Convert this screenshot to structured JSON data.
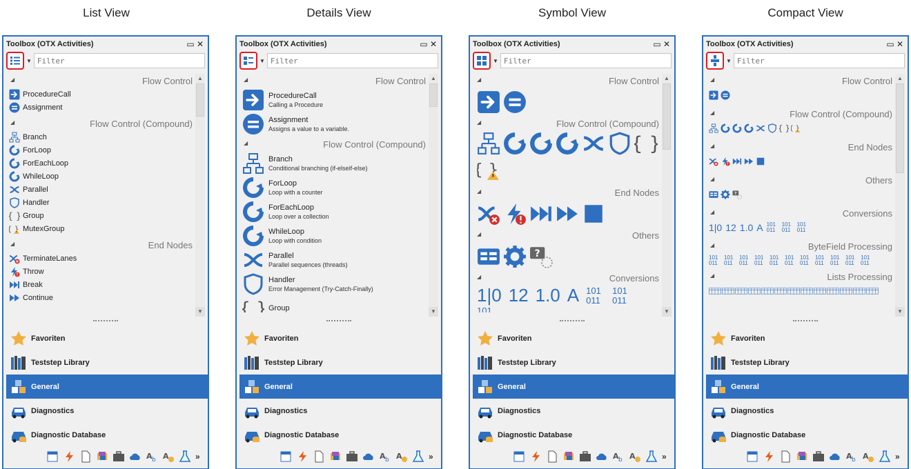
{
  "view_titles": [
    "List View",
    "Details View",
    "Symbol View",
    "Compact View"
  ],
  "toolbox": {
    "title": "Toolbox (OTX Activities)",
    "filter_placeholder": "Filter"
  },
  "categories": {
    "flow_control": "Flow Control",
    "flow_control_compound": "Flow Control (Compound)",
    "end_nodes": "End Nodes",
    "others": "Others",
    "conversions": "Conversions",
    "bytefield_processing": "ByteField Processing",
    "lists_processing": "Lists Processing"
  },
  "list_view": {
    "flow_control": [
      "ProcedureCall",
      "Assignment"
    ],
    "flow_control_compound": [
      "Branch",
      "ForLoop",
      "ForEachLoop",
      "WhileLoop",
      "Parallel",
      "Handler",
      "Group",
      "MutexGroup"
    ],
    "end_nodes": [
      "TerminateLanes",
      "Throw",
      "Break",
      "Continue"
    ]
  },
  "details_view": {
    "flow_control": [
      {
        "name": "ProcedureCall",
        "desc": "Calling a Procedure"
      },
      {
        "name": "Assignment",
        "desc": "Assigns a value to a variable."
      }
    ],
    "flow_control_compound": [
      {
        "name": "Branch",
        "desc": "Conditional branching (if-elseif-else)"
      },
      {
        "name": "ForLoop",
        "desc": "Loop with a counter"
      },
      {
        "name": "ForEachLoop",
        "desc": "Loop over a collection"
      },
      {
        "name": "WhileLoop",
        "desc": "Loop with condition"
      },
      {
        "name": "Parallel",
        "desc": "Parallel sequences (threads)"
      },
      {
        "name": "Handler",
        "desc": "Error Management (Try-Catch-Finally)"
      },
      {
        "name": "Group",
        "desc": ""
      }
    ]
  },
  "conversion_glyphs": [
    "1|0",
    "12",
    "1.0",
    "A"
  ],
  "binary_glyph": "101 011",
  "nav": [
    "Favoriten",
    "Teststep Library",
    "General",
    "Diagnostics",
    "Diagnostic Database"
  ],
  "nav_active": "General",
  "more_label": "»",
  "colors": {
    "accent": "#2e6fc0",
    "highlight_border": "#e31b23",
    "panel_bg": "#f0f0f0",
    "star": "#f0b040"
  }
}
